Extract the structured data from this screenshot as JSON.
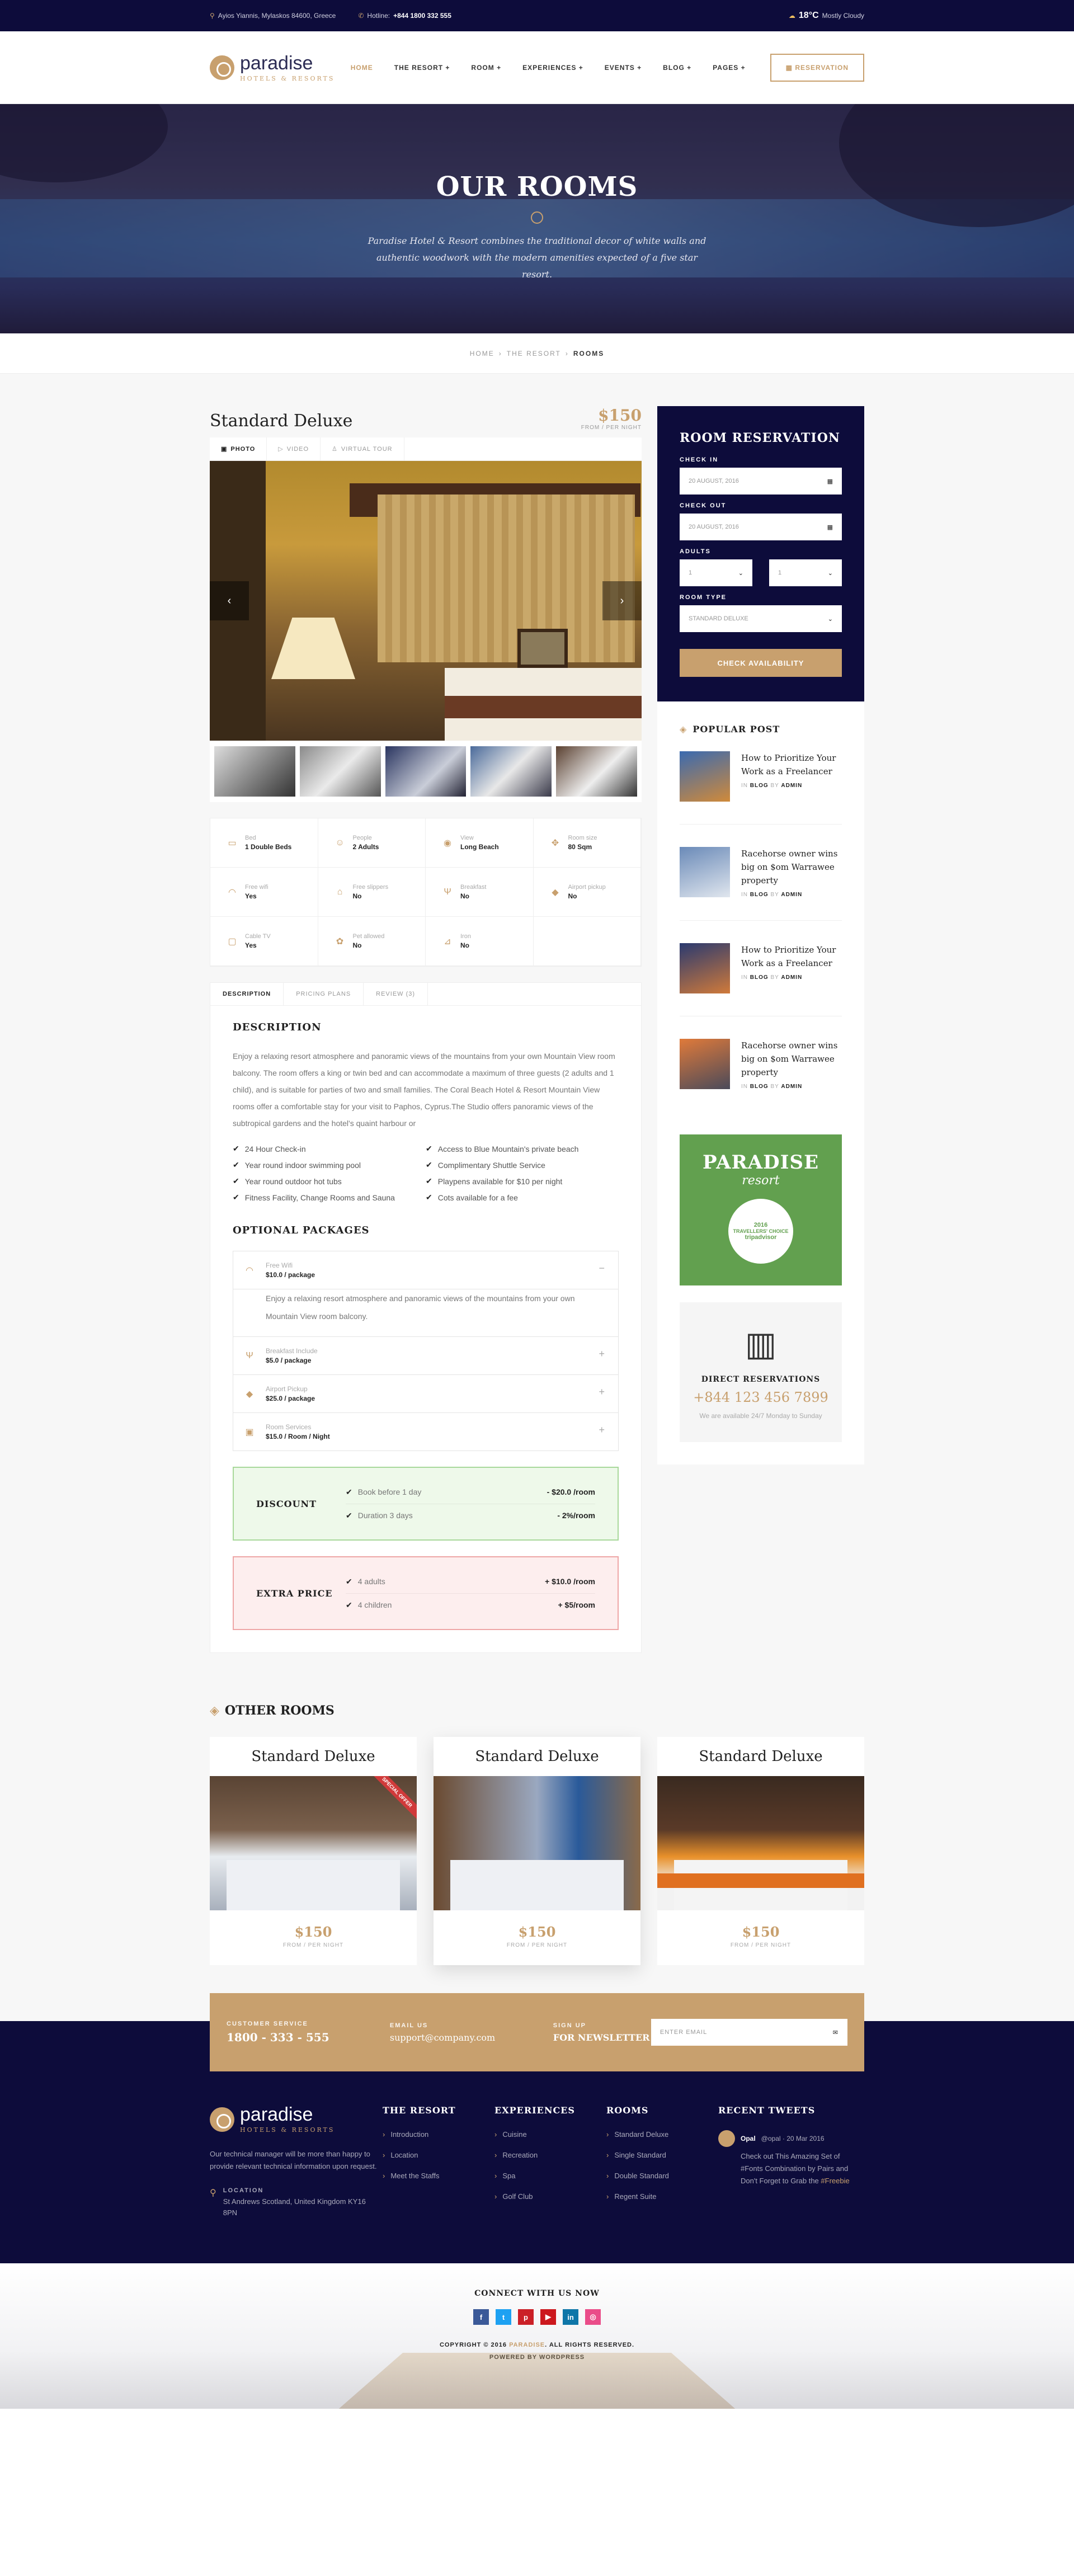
{
  "topbar": {
    "address": "Ayios Yiannis, Mylaskos 84600, Greece",
    "hotline_label": "Hotline:",
    "hotline": "+844 1800 332 555",
    "temp": "18°C",
    "weather": "Mostly Cloudy"
  },
  "header": {
    "logo_name": "paradise",
    "logo_sub": "HOTELS & RESORTS",
    "nav": [
      "HOME",
      "THE RESORT +",
      "ROOM +",
      "EXPERIENCES +",
      "EVENTS +",
      "BLOG +",
      "PAGES +"
    ],
    "reservation": "RESERVATION"
  },
  "hero": {
    "title": "OUR ROOMS",
    "text": "Paradise Hotel & Resort combines the traditional decor of white walls and authentic woodwork with the modern amenities expected of a five star resort."
  },
  "breadcrumb": [
    "HOME",
    "THE RESORT",
    "ROOMS"
  ],
  "room": {
    "title": "Standard Deluxe",
    "price": "$150",
    "price_sub": "FROM / PER NIGHT",
    "gallery_tabs": [
      "PHOTO",
      "VIDEO",
      "VIRTUAL TOUR"
    ],
    "amenities": [
      {
        "k": "Bed",
        "v": "1 Double Beds",
        "icon": "bed-icon",
        "glyph": "▭"
      },
      {
        "k": "People",
        "v": "2 Adults",
        "icon": "people-icon",
        "glyph": "☺"
      },
      {
        "k": "View",
        "v": "Long Beach",
        "icon": "eye-icon",
        "glyph": "◉"
      },
      {
        "k": "Room size",
        "v": "80 Sqm",
        "icon": "resize-icon",
        "glyph": "✥"
      },
      {
        "k": "Free wifi",
        "v": "Yes",
        "icon": "wifi-icon",
        "glyph": "◠"
      },
      {
        "k": "Free slippers",
        "v": "No",
        "icon": "slippers-icon",
        "glyph": "⌂"
      },
      {
        "k": "Breakfast",
        "v": "No",
        "icon": "cutlery-icon",
        "glyph": "Ψ"
      },
      {
        "k": "Airport pickup",
        "v": "No",
        "icon": "car-icon",
        "glyph": "◆"
      },
      {
        "k": "Cable TV",
        "v": "Yes",
        "icon": "tv-icon",
        "glyph": "▢"
      },
      {
        "k": "Pet allowed",
        "v": "No",
        "icon": "pet-icon",
        "glyph": "✿"
      },
      {
        "k": "Iron",
        "v": "No",
        "icon": "iron-icon",
        "glyph": "⊿"
      },
      {
        "k": "",
        "v": "",
        "icon": "",
        "glyph": ""
      }
    ],
    "tabs": [
      "DESCRIPTION",
      "PRICING PLANS",
      "REVIEW (3)"
    ],
    "desc_title": "DESCRIPTION",
    "description": "Enjoy a relaxing resort atmosphere and panoramic views of the mountains from your own Mountain View room balcony. The room offers a king or twin bed and can accommodate a maximum of three guests (2 adults and 1 child), and is suitable for parties of two and small families.  The Coral Beach Hotel & Resort Mountain View rooms offer a comfortable stay for your visit to Paphos, Cyprus.The Studio offers panoramic views of the subtropical gardens and the hotel's quaint harbour or",
    "features": [
      "24 Hour Check-in",
      "Access to Blue Mountain's private beach",
      "Year round indoor swimming pool",
      "Complimentary Shuttle Service",
      "Year round outdoor hot tubs",
      "Playpens available for $10 per night",
      "Fitness Facility, Change Rooms and Sauna",
      "Cots available for a fee"
    ],
    "packages_title": "OPTIONAL PACKAGES",
    "packages": [
      {
        "k": "Free Wifi",
        "v": "$10.0 / package",
        "sign": "−",
        "icon": "wifi-icon",
        "glyph": "◠"
      },
      {
        "k": "Breakfast Include",
        "v": "$5.0 / package",
        "sign": "+",
        "icon": "cutlery-icon",
        "glyph": "Ψ"
      },
      {
        "k": "Airport Pickup",
        "v": "$25.0 / package",
        "sign": "+",
        "icon": "car-icon",
        "glyph": "◆"
      },
      {
        "k": "Room Services",
        "v": "$15.0 / Room / Night",
        "sign": "+",
        "icon": "service-icon",
        "glyph": "▣"
      }
    ],
    "package_open_text": "Enjoy a relaxing resort atmosphere and panoramic views of the mountains from your own Mountain View room balcony.",
    "discount": {
      "label": "DISCOUNT",
      "rows": [
        {
          "l": "Book before 1 day",
          "r": "- $20.0 /room"
        },
        {
          "l": "Duration 3 days",
          "r": "- 2%/room"
        }
      ]
    },
    "extra": {
      "label": "EXTRA PRICE",
      "rows": [
        {
          "l": "4 adults",
          "r": "+ $10.0 /room"
        },
        {
          "l": "4 children",
          "r": "+ $5/room"
        }
      ]
    }
  },
  "reservation": {
    "title": "ROOM RESERVATION",
    "check_in_label": "CHECK IN",
    "check_in": "20 AUGUST, 2016",
    "check_out_label": "CHECK OUT",
    "check_out": "20 AUGUST, 2016",
    "adults_label": "ADULTS",
    "adults": "1",
    "children": "1",
    "room_type_label": "ROOM TYPE",
    "room_type": "STANDARD DELUXE",
    "button": "CHECK AVAILABILITY"
  },
  "popular": {
    "title": "POPULAR POST",
    "posts": [
      {
        "t": "How to Prioritize Your Work as a Freelancer",
        "in": "IN",
        "cat": "BLOG",
        "by": "BY",
        "author": "ADMIN",
        "c1": "#3a6ab0",
        "c2": "#d08a3a"
      },
      {
        "t": "Racehorse owner wins big on $om Warrawee property",
        "in": "IN",
        "cat": "BLOG",
        "by": "BY",
        "author": "ADMIN",
        "c1": "#6a8ab8",
        "c2": "#e0e6ee"
      },
      {
        "t": "How to Prioritize Your Work as a Freelancer",
        "in": "IN",
        "cat": "BLOG",
        "by": "BY",
        "author": "ADMIN",
        "c1": "#2a3a70",
        "c2": "#d07a3a"
      },
      {
        "t": "Racehorse owner wins big on $om Warrawee property",
        "in": "IN",
        "cat": "BLOG",
        "by": "BY",
        "author": "ADMIN",
        "c1": "#e07a3a",
        "c2": "#4a4a5a"
      }
    ]
  },
  "trip": {
    "a": "PARADISE",
    "b": "resort",
    "year": "2016",
    "choice": "TRAVELLERS' CHOICE",
    "brand": "tripadvisor"
  },
  "direct": {
    "title": "DIRECT RESERVATIONS",
    "phone": "+844 123 456 7899",
    "sub": "We are available 24/7 Monday to Sunday"
  },
  "other": {
    "title": "OTHER ROOMS",
    "rooms": [
      {
        "t": "Standard Deluxe",
        "p": "$150",
        "s": "FROM / PER NIGHT",
        "ribbon": "SPECIAL OFFER"
      },
      {
        "t": "Standard Deluxe",
        "p": "$150",
        "s": "FROM / PER NIGHT",
        "ribbon": ""
      },
      {
        "t": "Standard Deluxe",
        "p": "$150",
        "s": "FROM / PER NIGHT",
        "ribbon": ""
      }
    ]
  },
  "band": {
    "service_k": "CUSTOMER SERVICE",
    "service_v": "1800 - 333 - 555",
    "email_k": "EMAIL US",
    "email_v": "support@company.com",
    "sign_k": "SIGN UP",
    "sign_v": "FOR NEWSLETTER",
    "placeholder": "ENTER EMAIL"
  },
  "footer": {
    "text": "Our technical manager will be more than happy to provide relevant technical information upon request.",
    "loc_k": "LOCATION",
    "loc_v": "St Andrews Scotland, United Kingdom KY16 8PN",
    "cols": [
      {
        "h": "THE RESORT",
        "items": [
          "Introduction",
          "Location",
          "Meet the Staffs"
        ]
      },
      {
        "h": "EXPERIENCES",
        "items": [
          "Cuisine",
          "Recreation",
          "Spa",
          "Golf Club"
        ]
      },
      {
        "h": "ROOMS",
        "items": [
          "Standard Deluxe",
          "Single Standard",
          "Double Standard",
          "Regent Suite"
        ]
      }
    ],
    "tweets_h": "RECENT TWEETS",
    "tweet_user": "Opal",
    "tweet_handle": "@opal · 20 Mar 2016",
    "tweet_body": "Check out This Amazing Set of #Fonts Combination by Pairs and Don't Forget to Grab the",
    "tweet_tag": "#Freebie"
  },
  "bottom": {
    "connect": "CONNECT WITH US NOW",
    "socials": [
      {
        "n": "facebook-icon",
        "g": "f",
        "c": "#3b5998"
      },
      {
        "n": "twitter-icon",
        "g": "t",
        "c": "#1da1f2"
      },
      {
        "n": "pinterest-icon",
        "g": "p",
        "c": "#cb2027"
      },
      {
        "n": "youtube-icon",
        "g": "▶",
        "c": "#cc181e"
      },
      {
        "n": "linkedin-icon",
        "g": "in",
        "c": "#0e76a8"
      },
      {
        "n": "dribbble-icon",
        "g": "◎",
        "c": "#ea4c89"
      }
    ],
    "copy_a": "COPYRIGHT © 2016",
    "copy_b": "PARADISE",
    "copy_c": ". ALL RIGHTS RESERVED.",
    "powered": "POWERED BY WORDPRESS"
  }
}
